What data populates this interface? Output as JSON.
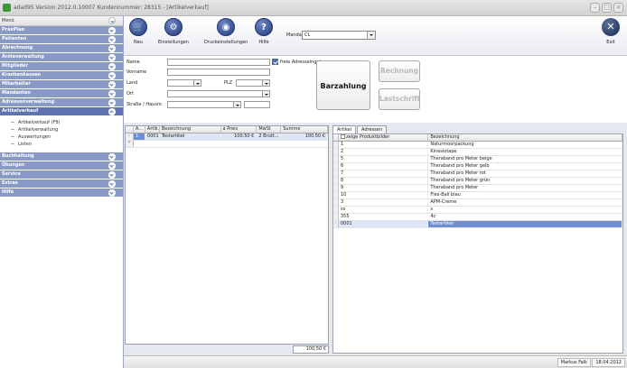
{
  "window": {
    "title": "adad95 Version 2012.0.10007 Kundennummer: 28315 - [Artikelverkauf]"
  },
  "sidebar": {
    "header": "Menü",
    "items": [
      {
        "label": "PraxPlan"
      },
      {
        "label": "Patienten"
      },
      {
        "label": "Abrechnung"
      },
      {
        "label": "Ärzteverwaltung"
      },
      {
        "label": "Mitglieder"
      },
      {
        "label": "Krankenkassen"
      },
      {
        "label": "Mitarbeiter"
      },
      {
        "label": "Mandanten"
      },
      {
        "label": "Adressenverwaltung"
      },
      {
        "label": "Artikelverkauf"
      }
    ],
    "subitems": [
      {
        "label": "Artikelverkauf (F8)"
      },
      {
        "label": "Artikelverwaltung"
      },
      {
        "label": "Auswertungen"
      },
      {
        "label": "Listen"
      }
    ],
    "items_after": [
      {
        "label": "Buchhaltung"
      },
      {
        "label": "Übungen"
      },
      {
        "label": "Service"
      },
      {
        "label": "Extras"
      },
      {
        "label": "Hilfe"
      }
    ]
  },
  "toolbar": {
    "new_label": "Neu",
    "settings_label": "Einstellungen",
    "print_settings_label": "Druckeinstellungen",
    "help_label": "Hilfe",
    "mandant_label": "Mandant",
    "mandant_value": "CL",
    "exit_label": "Exit"
  },
  "form": {
    "name_label": "Name",
    "vorname_label": "Vorname",
    "land_label": "Land",
    "plz_label": "PLZ",
    "ort_label": "Ort",
    "strasse_label": "Straße / Hausnr.",
    "free_address_label": "freie Adresseingabe",
    "barzahlung_label": "Barzahlung",
    "rechnung_label": "Rechnung",
    "lastschrift_label": "Lastschrift"
  },
  "cart": {
    "columns": [
      "A...",
      "Artik...",
      "Bezeichnung",
      "á Preis",
      "MwSt",
      "Summe"
    ],
    "rows": [
      {
        "a": "1",
        "art": "0001",
        "bez": "Testartikel",
        "preis": "100,50 €",
        "mwst": "2 Brutt...",
        "summe": "100,50 €"
      }
    ],
    "total": "100,50 €"
  },
  "articles": {
    "tabs": [
      "Artikel",
      "Adressen"
    ],
    "columns": [
      "zeige Produktbilder",
      "Bezeichnung"
    ],
    "rows": [
      {
        "nr": "1",
        "bez": "Naturmoorpackung"
      },
      {
        "nr": "2",
        "bez": "Kinesiotape"
      },
      {
        "nr": "5",
        "bez": "Theraband pro Meter beige"
      },
      {
        "nr": "6",
        "bez": "Theraband pro Meter gelb"
      },
      {
        "nr": "7",
        "bez": "Theraband pro Meter rot"
      },
      {
        "nr": "8",
        "bez": "Theraband pro Meter grün"
      },
      {
        "nr": "9",
        "bez": "Theraband pro Meter"
      },
      {
        "nr": "10",
        "bez": "Flex-Ball blau"
      },
      {
        "nr": "3",
        "bez": "APM-Creme"
      },
      {
        "nr": "ss",
        "bez": "s"
      },
      {
        "nr": "355",
        "bez": "4c"
      },
      {
        "nr": "0001",
        "bez": "Testartikel"
      }
    ]
  },
  "status": {
    "user": "Markus Falk",
    "date": "18.04.2012"
  }
}
